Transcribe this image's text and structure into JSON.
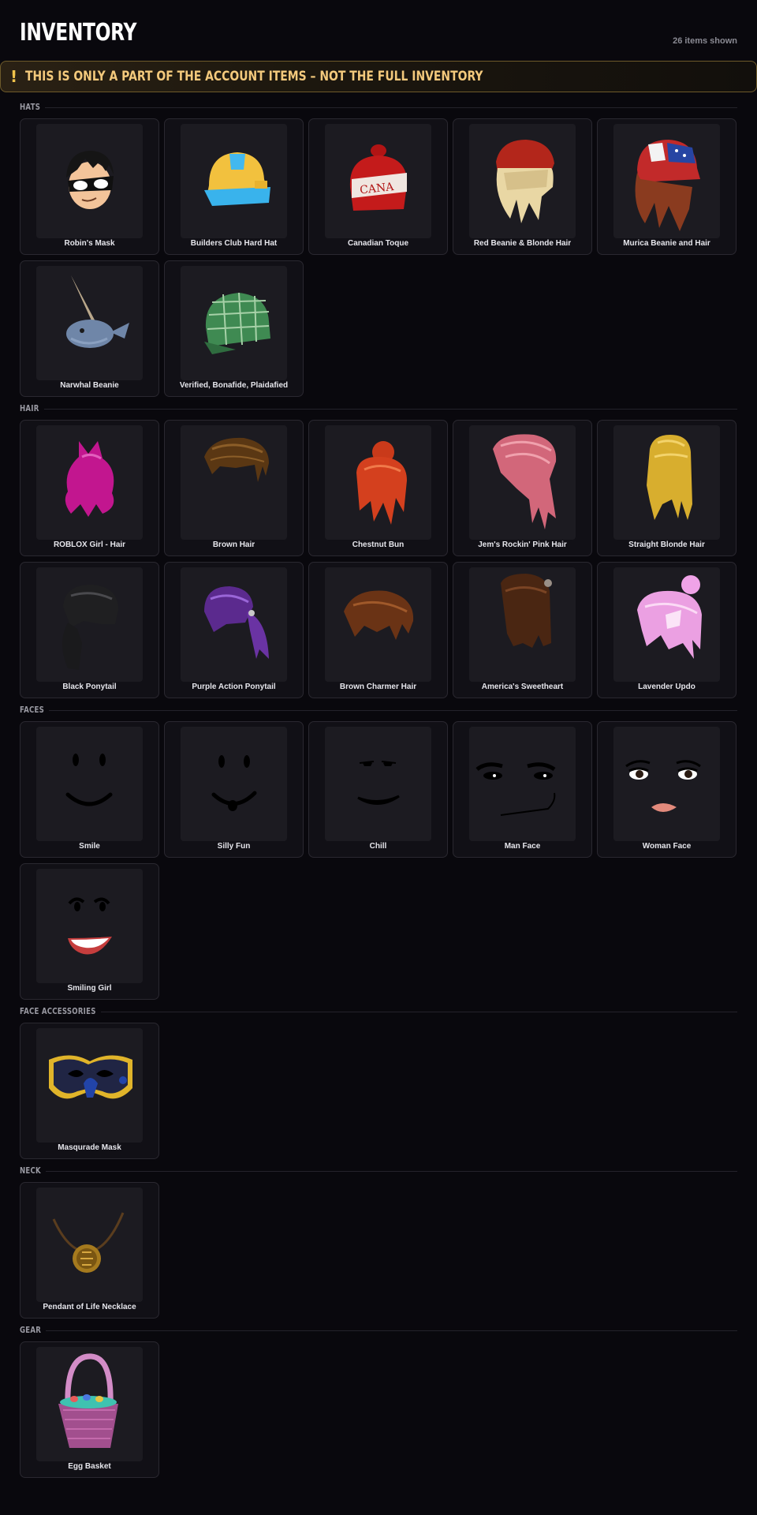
{
  "header": {
    "title": "INVENTORY",
    "count_text": "26 items shown"
  },
  "notice": {
    "icon": "!",
    "text": "THIS IS ONLY A PART OF THE ACCOUNT ITEMS – NOT THE FULL INVENTORY"
  },
  "sections": [
    {
      "label": "HATS",
      "items": [
        {
          "name": "Robin's Mask",
          "icon": "robin-mask-icon"
        },
        {
          "name": "Builders Club Hard Hat",
          "icon": "hard-hat-icon"
        },
        {
          "name": "Canadian Toque",
          "icon": "toque-icon"
        },
        {
          "name": "Red Beanie & Blonde Hair",
          "icon": "red-beanie-icon"
        },
        {
          "name": "Murica Beanie and Hair",
          "icon": "flag-beanie-icon"
        },
        {
          "name": "Narwhal Beanie",
          "icon": "narwhal-icon"
        },
        {
          "name": "Verified, Bonafide, Plaidafied",
          "icon": "plaid-cap-icon"
        }
      ]
    },
    {
      "label": "HAIR",
      "items": [
        {
          "name": "ROBLOX Girl - Hair",
          "icon": "pink-hair-icon"
        },
        {
          "name": "Brown Hair",
          "icon": "brown-hair-icon"
        },
        {
          "name": "Chestnut Bun",
          "icon": "chestnut-bun-icon"
        },
        {
          "name": "Jem's Rockin' Pink Hair",
          "icon": "pink-long-hair-icon"
        },
        {
          "name": "Straight Blonde Hair",
          "icon": "blonde-hair-icon"
        },
        {
          "name": "Black Ponytail",
          "icon": "black-ponytail-icon"
        },
        {
          "name": "Purple Action Ponytail",
          "icon": "purple-ponytail-icon"
        },
        {
          "name": "Brown Charmer Hair",
          "icon": "charmer-hair-icon"
        },
        {
          "name": "America's Sweetheart",
          "icon": "sweetheart-hair-icon"
        },
        {
          "name": "Lavender Updo",
          "icon": "lavender-updo-icon"
        }
      ]
    },
    {
      "label": "FACES",
      "items": [
        {
          "name": "Smile",
          "icon": "smile-face-icon"
        },
        {
          "name": "Silly Fun",
          "icon": "silly-face-icon"
        },
        {
          "name": "Chill",
          "icon": "chill-face-icon"
        },
        {
          "name": "Man Face",
          "icon": "man-face-icon"
        },
        {
          "name": "Woman Face",
          "icon": "woman-face-icon"
        },
        {
          "name": "Smiling Girl",
          "icon": "smiling-girl-face-icon"
        }
      ]
    },
    {
      "label": "FACE ACCESSORIES",
      "items": [
        {
          "name": "Masqurade Mask",
          "icon": "masquerade-mask-icon"
        }
      ]
    },
    {
      "label": "NECK",
      "items": [
        {
          "name": "Pendant of Life Necklace",
          "icon": "pendant-icon"
        }
      ]
    },
    {
      "label": "GEAR",
      "items": [
        {
          "name": "Egg Basket",
          "icon": "egg-basket-icon"
        }
      ]
    }
  ]
}
